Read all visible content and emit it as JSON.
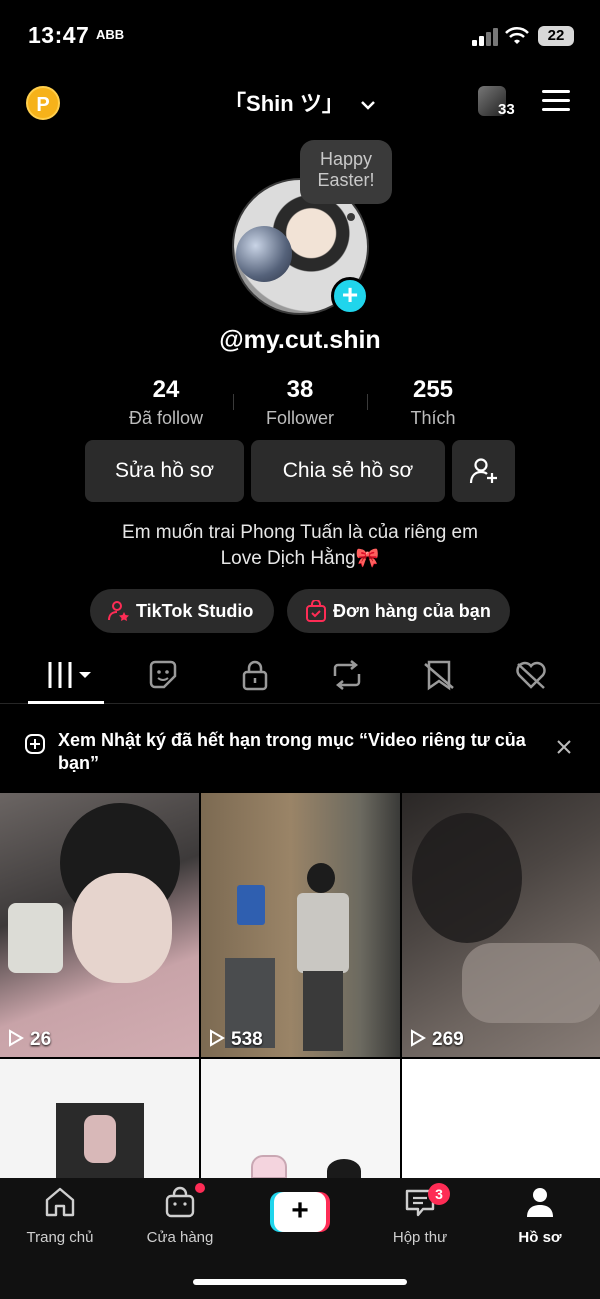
{
  "status_bar": {
    "time": "13:47",
    "carrier_glyph": "ABB",
    "battery": "22"
  },
  "header": {
    "username": "「Shin ツ」",
    "friends_count": "33",
    "coin_letter": "P"
  },
  "profile": {
    "note": "Happy Easter!",
    "handle": "@my.cut.shin",
    "stats": [
      {
        "value": "24",
        "label": "Đã follow"
      },
      {
        "value": "38",
        "label": "Follower"
      },
      {
        "value": "255",
        "label": "Thích"
      }
    ],
    "edit_label": "Sửa hồ sơ",
    "share_label": "Chia sẻ hồ sơ",
    "bio_line1": "Em muốn trai Phong Tuấn là của riêng em",
    "bio_line2": "Love Dịch Hằng🎀",
    "studio_label": "TikTok Studio",
    "orders_label": "Đơn hàng của bạn"
  },
  "tabs": [
    {
      "icon": "grid-icon",
      "active": true
    },
    {
      "icon": "sticker-icon"
    },
    {
      "icon": "lock-icon"
    },
    {
      "icon": "repost-icon"
    },
    {
      "icon": "bookmark-icon"
    },
    {
      "icon": "liked-icon"
    }
  ],
  "notice": {
    "text": "Xem Nhật ký đã hết hạn trong mục “Video riêng tư của bạn”"
  },
  "videos": [
    {
      "views": "26"
    },
    {
      "views": "538"
    },
    {
      "views": "269"
    },
    {
      "views": ""
    },
    {
      "views": ""
    },
    {
      "views": ""
    }
  ],
  "nav": [
    {
      "label": "Trang chủ",
      "icon": "home-icon"
    },
    {
      "label": "Cửa hàng",
      "icon": "shop-icon"
    },
    {
      "label": "",
      "icon": "create-icon"
    },
    {
      "label": "Hộp thư",
      "icon": "inbox-icon",
      "badge": "3"
    },
    {
      "label": "Hồ sơ",
      "icon": "profile-icon",
      "active": true
    }
  ],
  "colors": {
    "accent_cyan": "#20d5ec",
    "accent_red": "#fe2c55",
    "coin": "#f6b21a"
  }
}
